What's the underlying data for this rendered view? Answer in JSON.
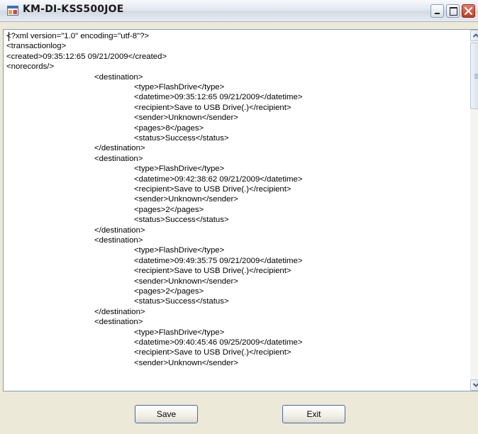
{
  "window": {
    "title": "KM-DI-KSS500JOE"
  },
  "editor": {
    "lines": [
      {
        "indent": 0,
        "text": "<?xml version=\"1.0\" encoding=\"utf-8\"?>"
      },
      {
        "indent": 0,
        "text": "<transactionlog>"
      },
      {
        "indent": 0,
        "text": "<created>09:35:12:65 09/21/2009</created>"
      },
      {
        "indent": 0,
        "text": "<norecords/>"
      },
      {
        "indent": 1,
        "text": "<destination>"
      },
      {
        "indent": 2,
        "text": "<type>FlashDrive</type>"
      },
      {
        "indent": 2,
        "text": "<datetime>09:35:12:65 09/21/2009</datetime>"
      },
      {
        "indent": 2,
        "text": "<recipient>Save to USB Drive(.)</recipient>"
      },
      {
        "indent": 2,
        "text": "<sender>Unknown</sender>"
      },
      {
        "indent": 2,
        "text": "<pages>8</pages>"
      },
      {
        "indent": 2,
        "text": "<status>Success</status>"
      },
      {
        "indent": 1,
        "text": "</destination>"
      },
      {
        "indent": 1,
        "text": "<destination>"
      },
      {
        "indent": 2,
        "text": "<type>FlashDrive</type>"
      },
      {
        "indent": 2,
        "text": "<datetime>09:42:38:62 09/21/2009</datetime>"
      },
      {
        "indent": 2,
        "text": "<recipient>Save to USB Drive(.)</recipient>"
      },
      {
        "indent": 2,
        "text": "<sender>Unknown</sender>"
      },
      {
        "indent": 2,
        "text": "<pages>2</pages>"
      },
      {
        "indent": 2,
        "text": "<status>Success</status>"
      },
      {
        "indent": 1,
        "text": "</destination>"
      },
      {
        "indent": 1,
        "text": "<destination>"
      },
      {
        "indent": 2,
        "text": "<type>FlashDrive</type>"
      },
      {
        "indent": 2,
        "text": "<datetime>09:49:35:75 09/21/2009</datetime>"
      },
      {
        "indent": 2,
        "text": "<recipient>Save to USB Drive(.)</recipient>"
      },
      {
        "indent": 2,
        "text": "<sender>Unknown</sender>"
      },
      {
        "indent": 2,
        "text": "<pages>2</pages>"
      },
      {
        "indent": 2,
        "text": "<status>Success</status>"
      },
      {
        "indent": 1,
        "text": "</destination>"
      },
      {
        "indent": 1,
        "text": "<destination>"
      },
      {
        "indent": 2,
        "text": "<type>FlashDrive</type>"
      },
      {
        "indent": 2,
        "text": "<datetime>09:40:45:46 09/25/2009</datetime>"
      },
      {
        "indent": 2,
        "text": "<recipient>Save to USB Drive(.)</recipient>"
      },
      {
        "indent": 2,
        "text": "<sender>Unknown</sender>"
      }
    ],
    "scroll_position": 0.0
  },
  "buttons": {
    "save_label": "Save",
    "exit_label": "Exit"
  },
  "icons": {
    "app": "app-window-icon",
    "minimize": "minimize-icon",
    "maximize": "maximize-icon",
    "close": "close-icon",
    "scroll_up": "scroll-up-arrow-icon",
    "scroll_down": "scroll-down-arrow-icon"
  },
  "colors": {
    "face": "#ece9d8",
    "border": "#7f9db9",
    "close_red": "#c13e20"
  }
}
